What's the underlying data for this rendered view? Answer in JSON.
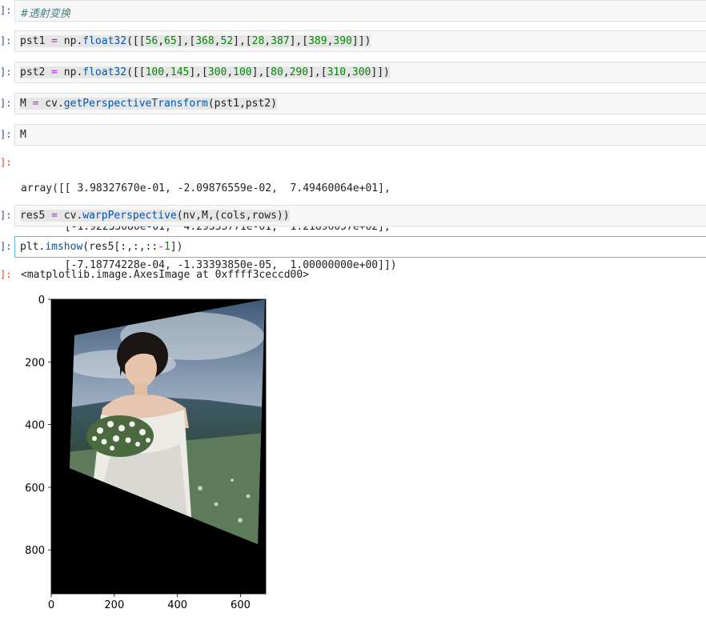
{
  "cells": [
    {
      "id": "c1",
      "prompt": "]:",
      "code": "#透射变换",
      "kind": "comment"
    },
    {
      "id": "c2",
      "prompt": "]:",
      "code": "pst1 = np.float32([[56,65],[368,52],[28,387],[389,390]])"
    },
    {
      "id": "c3",
      "prompt": "]:",
      "code": "pst2 = np.float32([[100,145],[300,100],[80,290],[310,300]])"
    },
    {
      "id": "c4",
      "prompt": "]:",
      "code": "M = cv.getPerspectiveTransform(pst1,pst2)"
    },
    {
      "id": "c5",
      "prompt": "]:",
      "code": "M"
    },
    {
      "id": "c7",
      "prompt": "]:",
      "code": "res5 = cv.warpPerspective(nv,M,(cols,rows))"
    },
    {
      "id": "c8",
      "prompt": "]:",
      "code": "plt.imshow(res5[:,:,::-1])",
      "active": true
    }
  ],
  "outputs": {
    "m_prompt": "]:",
    "m_lines": [
      "array([[ 3.98327670e-01, -2.09876559e-02,  7.49460064e+01],",
      "       [-1.92233080e-01,  4.29335771e-01,  1.21896057e+02],",
      "       [-7.18774228e-04, -1.33393850e-05,  1.00000000e+00]])"
    ],
    "imshow_prompt": "]:",
    "imshow_repr": "<matplotlib.image.AxesImage at 0xffff3ceccd00>"
  },
  "chart_data": {
    "type": "image",
    "xticks": [
      "0",
      "200",
      "400",
      "600"
    ],
    "yticks": [
      "0",
      "200",
      "400",
      "600",
      "800"
    ],
    "xlim": [
      0,
      680
    ],
    "ylim": [
      940,
      0
    ],
    "image_content": "perspective-warped photo of a woman in a white dress holding a bouquet of white flowers, sky and hills background, black padding outside the warped quadrilateral"
  },
  "colors": {
    "prompt_in": "#303f9f",
    "prompt_out": "#d84315",
    "operator": "#aa22ff",
    "number": "#008800",
    "function": "#0055aa",
    "comment": "#408080",
    "active_border": "#64b5f6"
  }
}
